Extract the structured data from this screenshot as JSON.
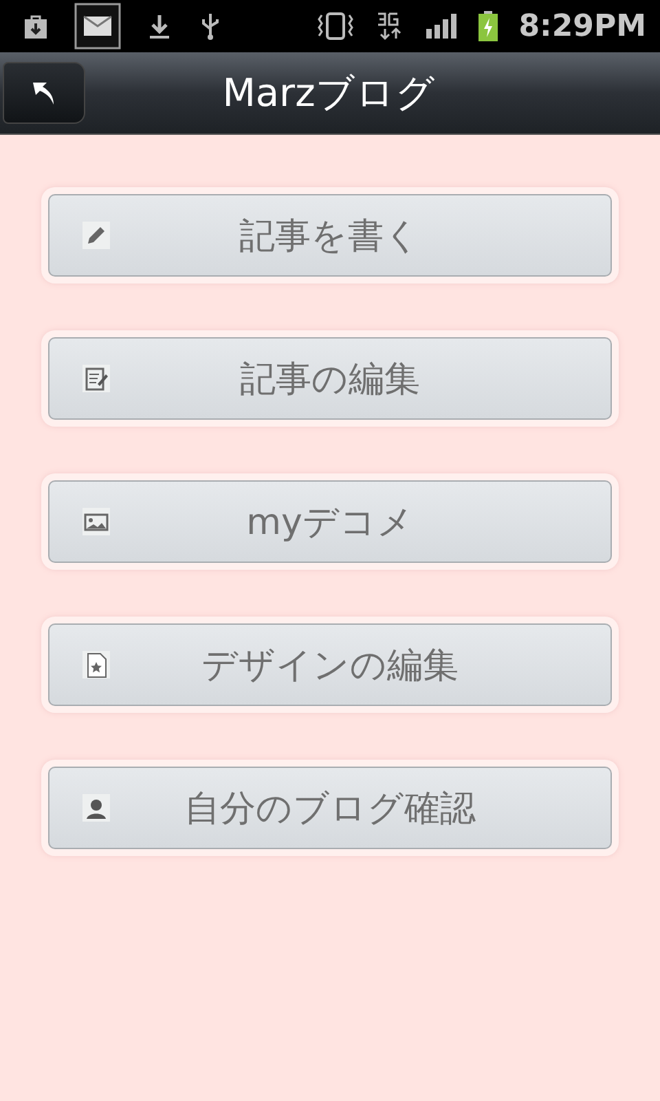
{
  "status_bar": {
    "time": "8:29PM"
  },
  "title_bar": {
    "title": "Marzブログ"
  },
  "menu": [
    {
      "label": "記事を書く",
      "kind": "pencil"
    },
    {
      "label": "記事の編集",
      "kind": "notepad"
    },
    {
      "label": "myデコメ",
      "kind": "image"
    },
    {
      "label": "デザインの編集",
      "kind": "star"
    },
    {
      "label": "自分のブログ確認",
      "kind": "person"
    }
  ]
}
